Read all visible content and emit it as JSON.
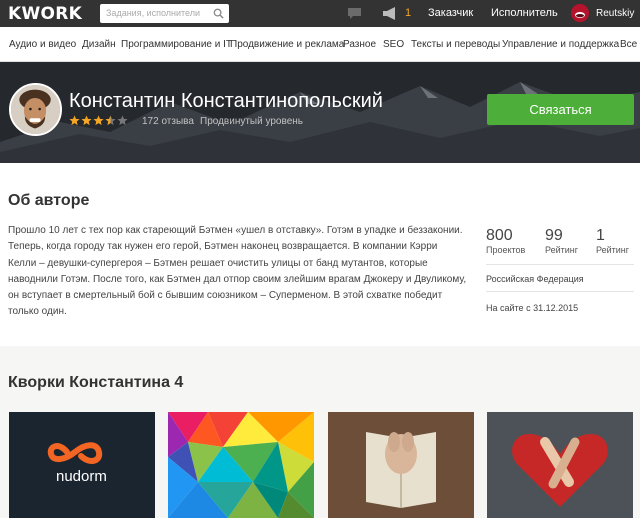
{
  "header": {
    "logo": "KWORK",
    "search_placeholder": "Задания, исполнители",
    "notification_count": "1",
    "nav": {
      "customer": "Заказчик",
      "freelancer": "Исполнитель"
    },
    "username": "Reutskiy"
  },
  "categories": [
    "Аудио и видео",
    "Дизайн",
    "Программирование и IT",
    "Продвижение и реклама",
    "Разное",
    "SEO",
    "Тексты и переводы",
    "Управление и поддержка",
    "Все"
  ],
  "profile": {
    "name": "Константин Константинопольский",
    "rating_stars": 3.5,
    "reviews": "172 отзыва",
    "level": "Продвинутый уровень",
    "contact_label": "Связаться"
  },
  "about": {
    "title": "Об авторе",
    "text": "Прошло 10 лет с тех пор как стареющий Бэтмен «ушел в отставку». Готэм в упадке и беззаконии. Теперь, когда городу так нужен его герой, Бэтмен наконец возвращается. В компании Кэрри Келли – девушки-супергероя – Бэтмен решает очистить улицы от банд мутантов, которые наводнили Готэм. После того, как Бэтмен дал отпор своим злейшим врагам Джокеру и Двуликому, он вступает в смертельный бой с бывшим союзником – Суперменом. В этой схватке победит только один.",
    "stats": [
      {
        "value": "800",
        "label": "Проектов"
      },
      {
        "value": "99",
        "label": "Рейтинг"
      },
      {
        "value": "1",
        "label": "Рейтинг"
      }
    ],
    "country": "Российская Федерация",
    "since": "На сайте с 31.12.2015"
  },
  "kworks": {
    "title": "Кворки Константина 4",
    "items": [
      {
        "brand": "nudorm"
      },
      {
        "brand": ""
      },
      {
        "brand": ""
      },
      {
        "brand": ""
      }
    ]
  },
  "colors": {
    "topbar": "#333333",
    "accent_green": "#4daf3a",
    "star": "#f5a623",
    "notification": "#f5a623"
  }
}
